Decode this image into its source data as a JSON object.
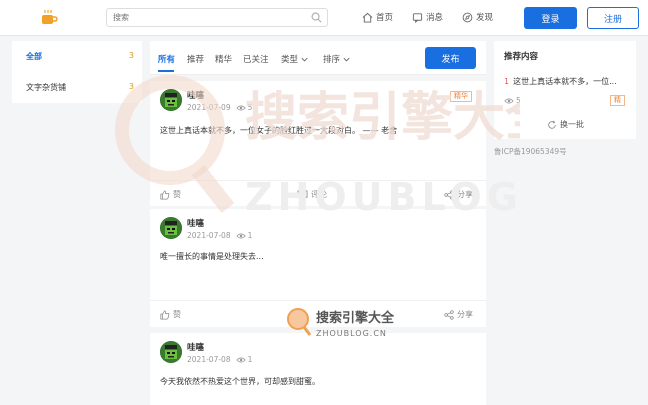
{
  "header": {
    "logo_icon": "coffee-cup-icon",
    "search_placeholder": "搜索",
    "nav": [
      {
        "label": "首页",
        "icon": "home-icon"
      },
      {
        "label": "消息",
        "icon": "message-icon"
      },
      {
        "label": "发现",
        "icon": "compass-icon"
      }
    ],
    "login_label": "登录",
    "register_label": "注册",
    "accent": "#1a6fe0"
  },
  "sidebar": {
    "categories": [
      {
        "label": "全部",
        "count": "3"
      },
      {
        "label": "文字杂货铺",
        "count": "3"
      }
    ]
  },
  "tabs": {
    "items": [
      "所有",
      "推荐",
      "精华",
      "已关注",
      "类型",
      "排序"
    ],
    "publish_label": "发布"
  },
  "posts": [
    {
      "author": "哇噻",
      "date": "2021-07-09",
      "views": "5",
      "badge": "精华",
      "content": "这世上真话本就不多，一位女子的脸红胜过一大段对白。 —— 老舍",
      "like_label": "赞",
      "comment_label": "评论",
      "share_label": "分享"
    },
    {
      "author": "哇噻",
      "date": "2021-07-08",
      "views": "1",
      "content": "唯一擅长的事情是处理失去...",
      "like_label": "赞",
      "share_label": "分享"
    },
    {
      "author": "哇噻",
      "date": "2021-07-08",
      "views": "1",
      "content": "今天我依然不热爱这个世界，可却感到甜蜜。"
    }
  ],
  "recommend": {
    "title": "推荐内容",
    "item_num": "1",
    "item_text": "这世上真话本就不多，一位...",
    "views": "5",
    "badge": "精",
    "refresh_label": "换一批"
  },
  "icp": "鲁ICP备19065349号",
  "watermark": {
    "big_text": "搜索引擎大全",
    "big_url": "ZHOUBLOG.CN",
    "small_text": "搜索引擎大全",
    "small_url": "ZHOUBLOG.CN"
  }
}
